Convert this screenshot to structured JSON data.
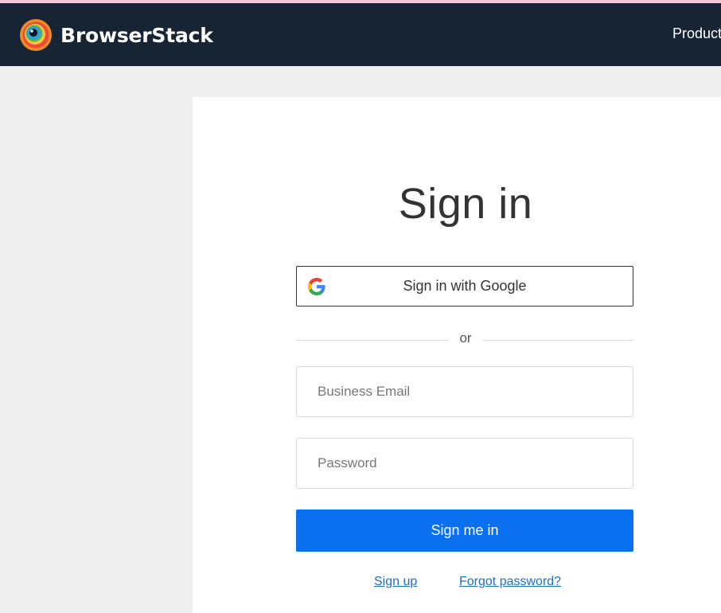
{
  "header": {
    "brand_name": "BrowserStack",
    "nav_item": "Products"
  },
  "signin": {
    "title": "Sign in",
    "google_button_label": "Sign in with Google",
    "divider_text": "or",
    "email_placeholder": "Business Email",
    "password_placeholder": "Password",
    "submit_label": "Sign me in",
    "signup_link": "Sign up",
    "forgot_link": "Forgot password?"
  },
  "colors": {
    "navbar_bg": "#172434",
    "primary_button": "#0a70f0",
    "link": "#1f6fbf",
    "page_bg": "#eeeeee"
  }
}
